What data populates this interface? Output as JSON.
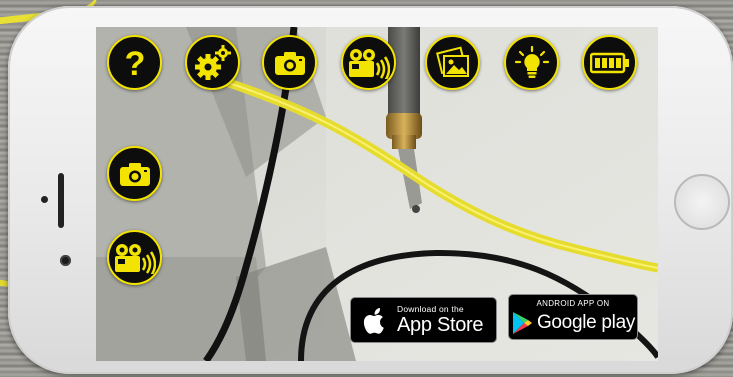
{
  "toolbar": {
    "icons": [
      {
        "name": "help-icon",
        "glyph": "?"
      },
      {
        "name": "settings-gears-icon"
      },
      {
        "name": "photo-camera-icon"
      },
      {
        "name": "video-camera-icon"
      },
      {
        "name": "gallery-icon"
      },
      {
        "name": "light-bulb-icon"
      },
      {
        "name": "battery-icon"
      }
    ]
  },
  "side_controls": [
    {
      "name": "snapshot-camera-icon"
    },
    {
      "name": "record-video-icon"
    }
  ],
  "badges": {
    "apple": {
      "small": "Download on the",
      "big": "App Store"
    },
    "google": {
      "small": "ANDROID APP ON",
      "big": "Google play"
    }
  },
  "colors": {
    "accent_yellow": "#f2e300",
    "icon_background": "#0d0d0d",
    "cable_yellow": "#e6dc2e"
  }
}
